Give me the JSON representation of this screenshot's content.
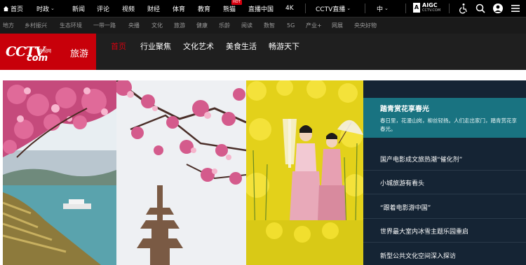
{
  "topnav": {
    "items": [
      {
        "label": "首页",
        "type": "home"
      },
      {
        "label": "时政",
        "dropdown": true
      },
      {
        "label": "新闻"
      },
      {
        "label": "评论"
      },
      {
        "label": "视频"
      },
      {
        "label": "财经"
      },
      {
        "label": "体育"
      },
      {
        "label": "教育"
      },
      {
        "label": "熊猫",
        "badge": "HOT"
      },
      {
        "label": "直播中国"
      },
      {
        "label": "4K"
      },
      {
        "label": "CCTV直播",
        "dropdown": true
      },
      {
        "label": "中",
        "dropdown": true
      }
    ],
    "aigc": {
      "title": "AIGC",
      "subtitle": "CCTV.COM"
    },
    "icons": [
      "accessibility-icon",
      "search-icon",
      "user-icon",
      "menu-icon"
    ]
  },
  "subnav": {
    "items": [
      "地方",
      "乡村振兴",
      "生态环境",
      "一带一路",
      "央播",
      "文化",
      "旅游",
      "健康",
      "乐龄",
      "阅读",
      "数智",
      "5G",
      "产业+",
      "网展",
      "央央好物"
    ]
  },
  "channel": {
    "logo_main": "CCTV",
    "logo_small": "央视网",
    "logo_com": "com",
    "logo_name": "旅游",
    "nav": [
      {
        "label": "首页",
        "active": true
      },
      {
        "label": "行业聚焦",
        "active": false
      },
      {
        "label": "文化艺术",
        "active": false
      },
      {
        "label": "美食生活",
        "active": false
      },
      {
        "label": "畅游天下",
        "active": false
      }
    ]
  },
  "hero": {
    "feature_title": "踏青赏花享春光",
    "feature_desc": "春日里，花漫山岗，柳丝轻扬。人们走出家门，踏青赏花享春光。",
    "news": [
      "国产电影成文旅热潮“催化剂”",
      "小城旅游有看头",
      "“跟着电影游中国”",
      "世界最大室内冰雪主题乐园重启",
      "新型公共文化空间深入探访"
    ]
  },
  "colors": {
    "brand_red": "#c8000a",
    "active_red": "#d7000f",
    "feature_teal": "#197381",
    "sidebar_navy": "#152434"
  }
}
